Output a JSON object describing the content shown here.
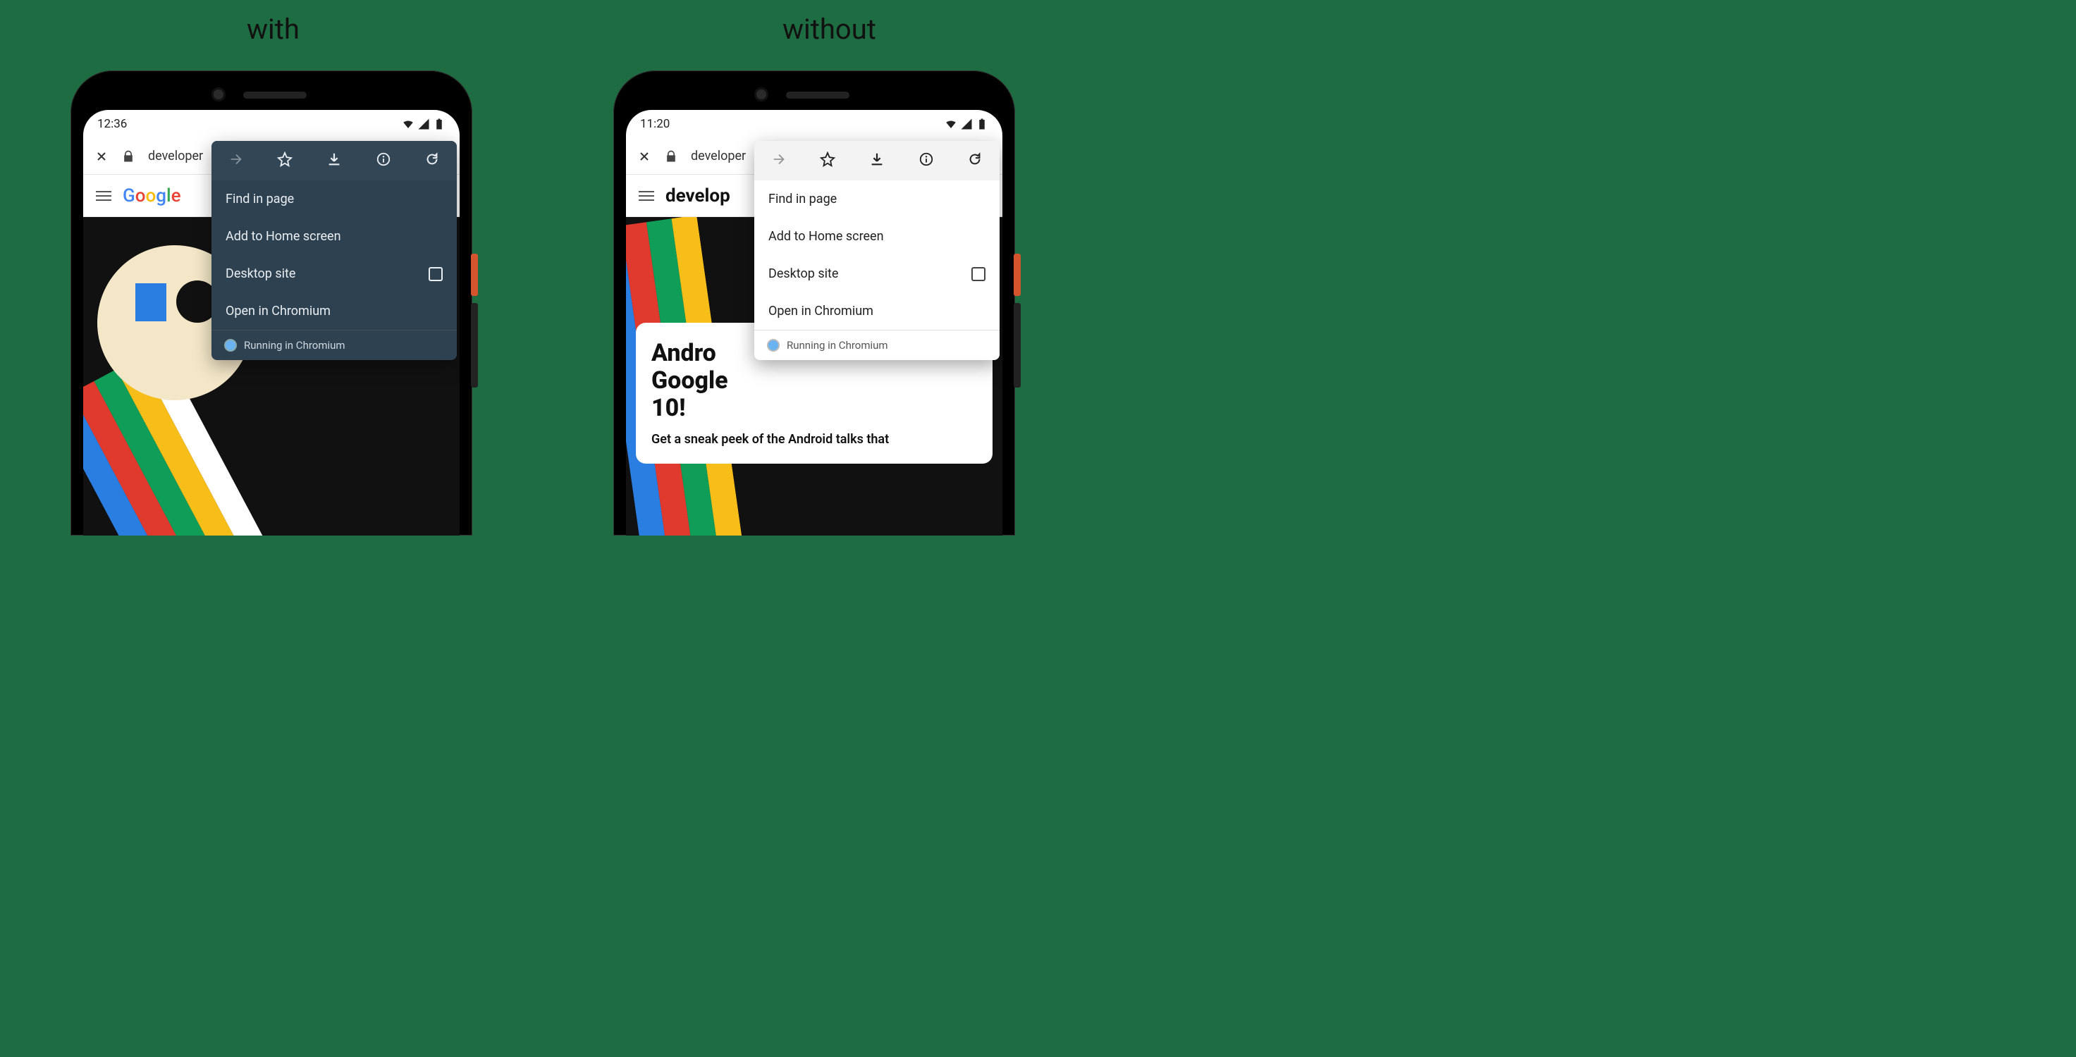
{
  "captions": {
    "left": "with",
    "right": "without"
  },
  "status": {
    "time_left": "12:36",
    "time_right": "11:20"
  },
  "urlbar": {
    "host": "developer"
  },
  "page": {
    "brand_google": [
      "G",
      "o",
      "o",
      "g",
      "l",
      "e"
    ],
    "brand_dev": "develop",
    "card_title": "Andro\nGoogle\n10!",
    "card_title_full_lines": [
      "Andro",
      "Google",
      "10!"
    ],
    "card_sub": "Get a sneak peek of the Android talks that"
  },
  "menu": {
    "items": {
      "find": "Find in page",
      "add": "Add to Home screen",
      "desktop": "Desktop site",
      "open": "Open in Chromium"
    },
    "footer": "Running in Chromium"
  }
}
